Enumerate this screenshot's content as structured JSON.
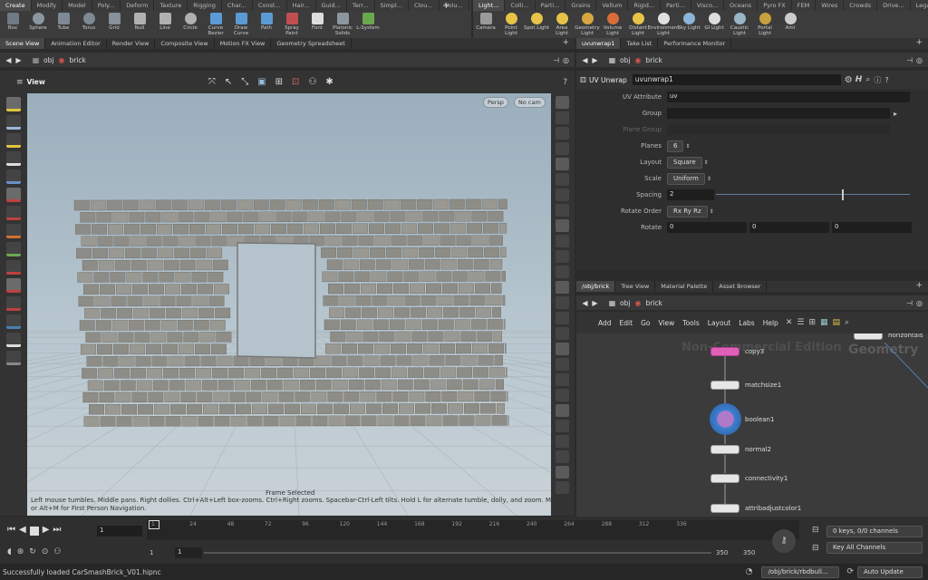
{
  "shelf_left": {
    "tabs": [
      "Create",
      "Modify",
      "Model",
      "Poly...",
      "Deform",
      "Texture",
      "Rigging",
      "Char...",
      "Const...",
      "Hair...",
      "Guid...",
      "Terr...",
      "Simpl...",
      "Clou...",
      "Volu..."
    ],
    "active": "Create",
    "tools": [
      [
        "Box",
        "box-icon",
        "#6f7a86"
      ],
      [
        "Sphere",
        "sphere-icon",
        "#8c96a0"
      ],
      [
        "Tube",
        "tube-icon",
        "#7f8994"
      ],
      [
        "Torus",
        "torus-icon",
        "#7f8994"
      ],
      [
        "Grid",
        "grid-icon",
        "#889098"
      ],
      [
        "Null",
        "null-icon",
        "#b0b0b0"
      ],
      [
        "Line",
        "line-icon",
        "#b0b0b0"
      ],
      [
        "Circle",
        "circle-icon",
        "#b0b0b0"
      ],
      [
        "Curve Bezier",
        "curve-bezier-icon",
        "#5b9bd5"
      ],
      [
        "Draw Curve",
        "draw-curve-icon",
        "#5b9bd5"
      ],
      [
        "Path",
        "path-icon",
        "#5b9bd5"
      ],
      [
        "Spray Paint",
        "spray-paint-icon",
        "#c05050"
      ],
      [
        "Font",
        "font-icon",
        "#dddddd"
      ],
      [
        "Platonic Solids",
        "platonic-solids-icon",
        "#8c96a0"
      ],
      [
        "L-System",
        "l-system-icon",
        "#6aa84f"
      ]
    ]
  },
  "shelf_right": {
    "tabs": [
      "Light...",
      "Colli...",
      "Parti...",
      "Grains",
      "Vellum",
      "Rigid...",
      "Parti...",
      "Visco...",
      "Oceans",
      "Pyro FX",
      "FEM",
      "Wires",
      "Crowds",
      "Drive...",
      "Legac..."
    ],
    "active": "Light...",
    "tools": [
      [
        "Camera",
        "camera-icon",
        "#9a9a9a"
      ],
      [
        "Point Light",
        "point-light-icon",
        "#e8c34a"
      ],
      [
        "Spot Light",
        "spot-light-icon",
        "#e8c34a"
      ],
      [
        "Area Light",
        "area-light-icon",
        "#e8c34a"
      ],
      [
        "Geometry Light",
        "geometry-light-icon",
        "#d9a640"
      ],
      [
        "Volume Light",
        "volume-light-icon",
        "#d96d3a"
      ],
      [
        "Distant Light",
        "distant-light-icon",
        "#e8c34a"
      ],
      [
        "Environment Light",
        "environment-light-icon",
        "#e0e0e0"
      ],
      [
        "Sky Light",
        "sky-light-icon",
        "#8ab4d8"
      ],
      [
        "GI Light",
        "gi-light-icon",
        "#dddddd"
      ],
      [
        "Caustic Light",
        "caustic-light-icon",
        "#9ab4c8"
      ],
      [
        "Portal Light",
        "portal-light-icon",
        "#c8a040"
      ],
      [
        "Ami",
        "ambient-light-icon",
        "#cccccc"
      ]
    ]
  },
  "left_pane": {
    "tabs": [
      "Scene View",
      "Animation Editor",
      "Render View",
      "Composite View",
      "Motion FX View",
      "Geometry Spreadsheet"
    ],
    "active": "Scene View",
    "path": [
      "obj",
      "brick"
    ]
  },
  "viewport": {
    "label": "View",
    "persp": "Persp",
    "cam": "No cam",
    "watermark": "Non-Commercial Edition",
    "status": "Frame Selected",
    "help": "Left mouse tumbles. Middle pans. Right dollies. Ctrl+Alt+Left box-zooms. Ctrl+Right zooms. Spacebar-Ctrl-Left tilts. Hold L for alternate tumble, dolly, and zoom.    M or Alt+M for First Person Navigation."
  },
  "param_pane": {
    "tabs": [
      "uvunwrap1",
      "Take List",
      "Performance Monitor"
    ],
    "path": [
      "obj",
      "brick"
    ],
    "node_type": "UV Unwrap",
    "node_name": "uvunwrap1",
    "params": {
      "uv_attribute": {
        "label": "UV Attribute",
        "value": "uv"
      },
      "group": {
        "label": "Group",
        "value": ""
      },
      "plane_group": {
        "label": "Plane Group",
        "value": ""
      },
      "planes": {
        "label": "Planes",
        "value": "6"
      },
      "layout": {
        "label": "Layout",
        "value": "Square"
      },
      "scale": {
        "label": "Scale",
        "value": "Uniform"
      },
      "spacing": {
        "label": "Spacing",
        "value": "2",
        "slider": 0.65
      },
      "rotate_order": {
        "label": "Rotate Order",
        "value": "Rx Ry Rz"
      },
      "rotate": {
        "label": "Rotate",
        "values": [
          "0",
          "0",
          "0"
        ]
      }
    }
  },
  "network_pane": {
    "tabs": [
      "/obj/brick",
      "Tree View",
      "Material Palette",
      "Asset Browser"
    ],
    "path": [
      "obj",
      "brick"
    ],
    "menu": [
      "Add",
      "Edit",
      "Go",
      "View",
      "Tools",
      "Layout",
      "Labs",
      "Help"
    ],
    "watermark": "Non-Commercial Edition",
    "context": "Geometry",
    "nodes": [
      "horizontals",
      "copy3",
      "matchsize1",
      "boolean1",
      "normal2",
      "connectivity1",
      "attribadjustcolor1"
    ]
  },
  "timeline": {
    "ticks": [
      "1",
      "24",
      "48",
      "72",
      "96",
      "120",
      "144",
      "168",
      "192",
      "216",
      "240",
      "264",
      "288",
      "312",
      "336"
    ],
    "frame": "1",
    "start": "1",
    "start2": "1",
    "end": "350",
    "end2": "350",
    "keys": "0 keys, 0/0 channels",
    "channels": "Key All Channels"
  },
  "statusbar": {
    "message": "Successfully loaded CarSmashBrick_V01.hipnc",
    "path": "/obj/brick/rbdbull...",
    "update": "Auto Update"
  }
}
